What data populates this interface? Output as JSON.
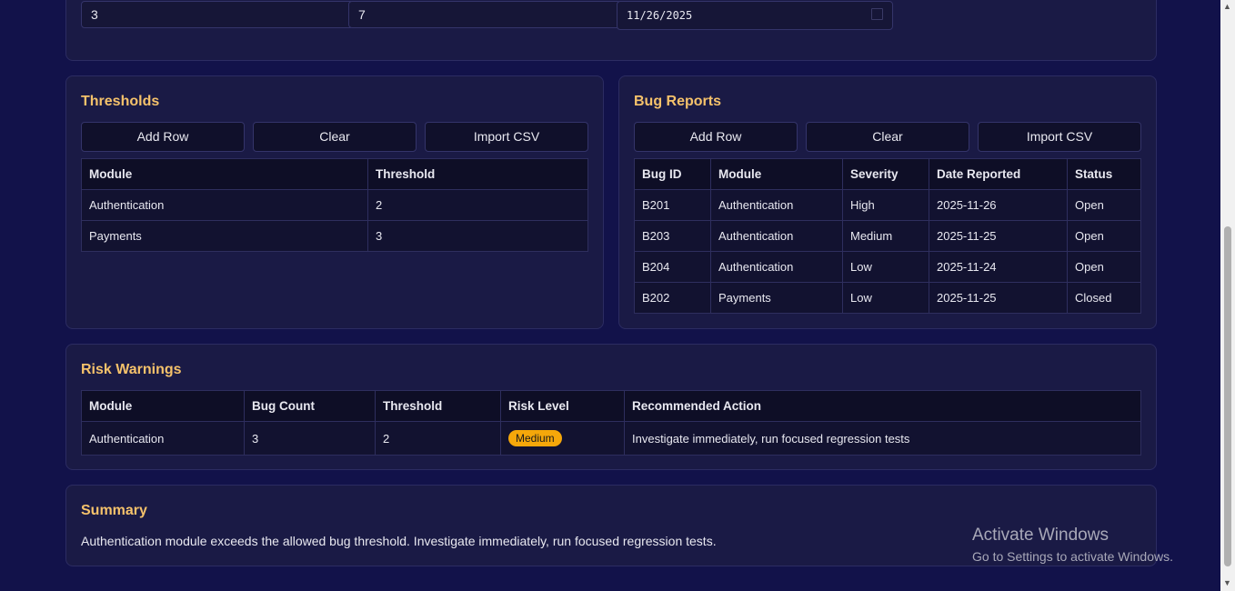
{
  "top_inputs": {
    "input1": "3",
    "input2": "7",
    "date": "11/26/2025"
  },
  "thresholds": {
    "title": "Thresholds",
    "buttons": {
      "add": "Add Row",
      "clear": "Clear",
      "import": "Import CSV"
    },
    "columns": [
      "Module",
      "Threshold"
    ],
    "rows": [
      [
        "Authentication",
        "2"
      ],
      [
        "Payments",
        "3"
      ]
    ]
  },
  "bug_reports": {
    "title": "Bug Reports",
    "buttons": {
      "add": "Add Row",
      "clear": "Clear",
      "import": "Import CSV"
    },
    "columns": [
      "Bug ID",
      "Module",
      "Severity",
      "Date Reported",
      "Status"
    ],
    "rows": [
      [
        "B201",
        "Authentication",
        "High",
        "2025-11-26",
        "Open"
      ],
      [
        "B203",
        "Authentication",
        "Medium",
        "2025-11-25",
        "Open"
      ],
      [
        "B204",
        "Authentication",
        "Low",
        "2025-11-24",
        "Open"
      ],
      [
        "B202",
        "Payments",
        "Low",
        "2025-11-25",
        "Closed"
      ]
    ]
  },
  "risk_warnings": {
    "title": "Risk Warnings",
    "columns": [
      "Module",
      "Bug Count",
      "Threshold",
      "Risk Level",
      "Recommended Action"
    ],
    "rows": [
      [
        "Authentication",
        "3",
        "2",
        "Medium",
        "Investigate immediately, run focused regression tests"
      ]
    ]
  },
  "summary": {
    "title": "Summary",
    "text": "Authentication module exceeds the allowed bug threshold. Investigate immediately, run focused regression tests."
  },
  "watermark": {
    "line1": "Activate Windows",
    "line2": "Go to Settings to activate Windows."
  },
  "colors": {
    "background": "#12124a",
    "panel": "#1a1a45",
    "heading": "#f5c26b",
    "badge_medium": "#f5a70a"
  }
}
